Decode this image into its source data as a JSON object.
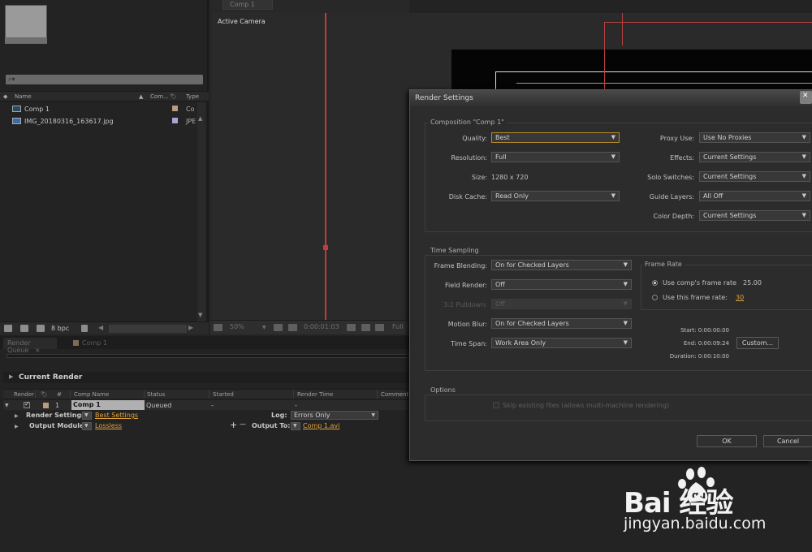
{
  "project": {
    "search_placeholder": "⌕▾",
    "columns": {
      "name": "Name",
      "comment": "Com...",
      "type": "Type"
    },
    "items": [
      {
        "name": "Comp 1",
        "type": "Co",
        "swatch": "#b89c7c"
      },
      {
        "name": "IMG_20180316_163617.jpg",
        "type": "JPE",
        "swatch": "#a7a5d3"
      }
    ],
    "bpc_label": "8 bpc"
  },
  "composition": {
    "tab_label": "Comp 1",
    "view_label": "Active Camera",
    "zoom": "50%",
    "timecode": "0:00:01:03",
    "footer_full": "Full"
  },
  "render_queue": {
    "tab_label": "Render Queue",
    "comp_tab_label": "Comp 1",
    "current_render_label": "Current Render",
    "headers": {
      "render": "Render",
      "num": "#",
      "comp_name": "Comp Name",
      "status": "Status",
      "started": "Started",
      "render_time": "Render Time",
      "comment": "Comment"
    },
    "row": {
      "num": "1",
      "comp_name": "Comp 1",
      "status": "Queued",
      "started": "-",
      "render_time": "-",
      "render_settings_label": "Render Settings:",
      "render_settings_value": "Best Settings",
      "output_module_label": "Output Module:",
      "output_module_value": "Lossless",
      "log_label": "Log:",
      "log_value": "Errors Only",
      "output_to_label": "Output To:",
      "output_to_value": "Comp 1.avi",
      "plus": "+",
      "minus": "—"
    }
  },
  "dialog": {
    "title": "Render Settings",
    "composition_group": "Composition \"Comp 1\"",
    "quality": {
      "label": "Quality:",
      "value": "Best"
    },
    "resolution": {
      "label": "Resolution:",
      "value": "Full"
    },
    "size": {
      "label": "Size:",
      "value": "1280 x 720"
    },
    "disk_cache": {
      "label": "Disk Cache:",
      "value": "Read Only"
    },
    "proxy_use": {
      "label": "Proxy Use:",
      "value": "Use No Proxies"
    },
    "effects": {
      "label": "Effects:",
      "value": "Current Settings"
    },
    "solo_switches": {
      "label": "Solo Switches:",
      "value": "Current Settings"
    },
    "guide_layers": {
      "label": "Guide Layers:",
      "value": "All Off"
    },
    "color_depth": {
      "label": "Color Depth:",
      "value": "Current Settings"
    },
    "time_sampling_group": "Time Sampling",
    "frame_blending": {
      "label": "Frame Blending:",
      "value": "On for Checked Layers"
    },
    "field_render": {
      "label": "Field Render:",
      "value": "Off"
    },
    "pulldown": {
      "label": "3:2 Pulldown:",
      "value": "Off"
    },
    "motion_blur": {
      "label": "Motion Blur:",
      "value": "On for Checked Layers"
    },
    "time_span": {
      "label": "Time Span:",
      "value": "Work Area Only"
    },
    "frame_rate_group": "Frame Rate",
    "use_comp_rate": {
      "label": "Use comp's frame rate",
      "value": "25.00"
    },
    "use_this_rate": {
      "label": "Use this frame rate:",
      "value": "30"
    },
    "start": "Start: 0:00:00:00",
    "end": "End: 0:00:09:24",
    "duration": "Duration: 0:00:10:00",
    "custom_button": "Custom...",
    "options_group": "Options",
    "skip_existing": "Skip existing files (allows multi-machine rendering)",
    "ok": "OK",
    "cancel": "Cancel"
  },
  "watermark": {
    "logo_text": "Bai  经验",
    "url": "jingyan.baidu.com"
  }
}
